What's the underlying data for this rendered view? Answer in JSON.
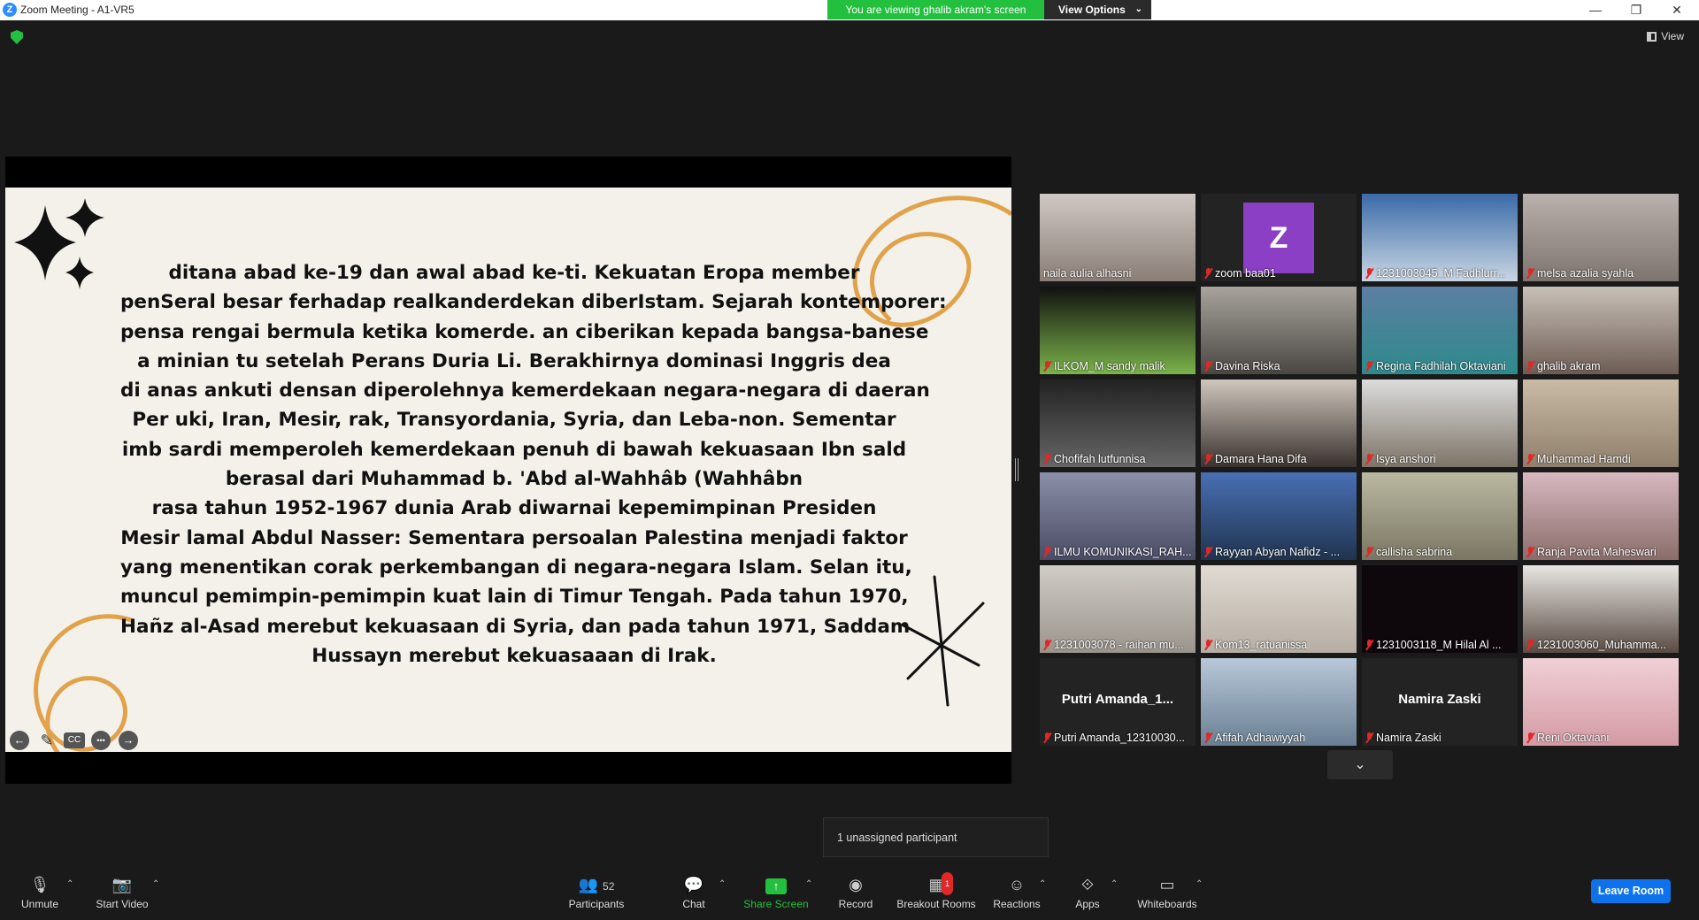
{
  "window": {
    "title": "Zoom Meeting - A1-VR5",
    "app_icon": "Z"
  },
  "banner": {
    "message": "You are viewing ghalib akram's screen",
    "view_options": "View Options"
  },
  "view_button": "View",
  "slide": {
    "lines": [
      "ditana abad ke-19 dan awal abad ke-ti. Kekuatan Eropa member",
      "penSeral besar ferhadap realkanderdekan diberIstam. Sejarah kontemporer:",
      "pensa rengai bermula ketika komerde. an ciberikan kepada bangsa-banese",
      "a minian tu setelah Perans Duria Li. Berakhirnya dominasi Inggris dea",
      "di anas ankuti densan diperolehnya kemerdekaan negara-negara di daeran",
      "Per uki, Iran, Mesir, rak, Transyordania, Syria, dan Leba-non. Sementar",
      "imb sardi memperoleh kemerdekaan penuh di bawah kekuasaan Ibn sald",
      "berasal dari Muhammad b. 'Abd al-Wahhâb (Wahhâbn",
      "rasa tahun 1952-1967 dunia Arab diwarnai kepemimpinan Presiden",
      "Mesir lamal Abdul Nasser: Sementara persoalan Palestina menjadi faktor",
      "yang menentikan corak perkembangan di negara-negara Islam. Selan itu,",
      "muncul pemimpin-pemimpin kuat lain di Timur Tengah. Pada tahun 1970,",
      "Hañz al-Asad merebut kekuasaan di Syria, dan pada tahun 1971, Saddam",
      "Hussayn merebut kekuasaaan di Irak."
    ],
    "controls": {
      "prev": "←",
      "pen": "✎",
      "cc": "CC",
      "more": "•••",
      "next": "→"
    }
  },
  "participants": [
    {
      "name": "naila aulia alhasni",
      "muted": false
    },
    {
      "name": "zoom baa01",
      "muted": true,
      "initial": "Z"
    },
    {
      "name": "1231003045_M Fadhlurr...",
      "muted": true
    },
    {
      "name": "melsa azalia syahla",
      "muted": true
    },
    {
      "name": "ILKOM_M sandy malik",
      "muted": true
    },
    {
      "name": "Davina Riska",
      "muted": true
    },
    {
      "name": "Regina Fadhilah Oktaviani",
      "muted": true
    },
    {
      "name": "ghalib akram",
      "muted": true,
      "active": true
    },
    {
      "name": "Chofifah lutfunnisa",
      "muted": true
    },
    {
      "name": "Damara Hana Difa",
      "muted": true
    },
    {
      "name": "Isya anshori",
      "muted": true
    },
    {
      "name": "Muhammad Hamdi",
      "muted": true
    },
    {
      "name": "ILMU KOMUNIKASI_RAH...",
      "muted": true
    },
    {
      "name": "Rayyan Abyan Nafidz - ...",
      "muted": true
    },
    {
      "name": "callisha sabrina",
      "muted": true
    },
    {
      "name": "Ranja Pavita Maheswari",
      "muted": true
    },
    {
      "name": "1231003078 - raihan mu...",
      "muted": true
    },
    {
      "name": "Kom13_ratuanissa",
      "muted": true
    },
    {
      "name": "1231003118_M Hilal Al ...",
      "muted": true
    },
    {
      "name": "1231003060_Muhamma...",
      "muted": true
    },
    {
      "name": "Putri Amanda_12310030...",
      "muted": true,
      "display_name": "Putri  Amanda_1..."
    },
    {
      "name": "Afifah Adhawiyyah",
      "muted": true
    },
    {
      "name": "Namira Zaski",
      "muted": true,
      "display_name": "Namira Zaski"
    },
    {
      "name": "Reni Oktaviani",
      "muted": true
    }
  ],
  "tooltip": "1 unassigned participant",
  "toolbar": {
    "unmute": "Unmute",
    "start_video": "Start Video",
    "participants": "Participants",
    "participants_count": "52",
    "chat": "Chat",
    "share_screen": "Share Screen",
    "record": "Record",
    "breakout_rooms": "Breakout Rooms",
    "breakout_badge": "1",
    "reactions": "Reactions",
    "apps": "Apps",
    "whiteboards": "Whiteboards",
    "leave": "Leave Room"
  },
  "colors": {
    "share_green": "#23c03f",
    "leave_blue": "#0e72ed",
    "active_border": "#d6e64a",
    "mute_red": "#e02828"
  }
}
